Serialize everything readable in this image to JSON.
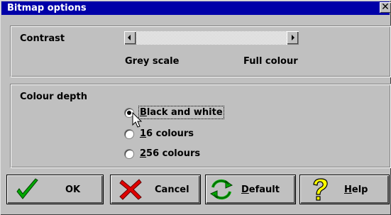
{
  "window": {
    "title": "Bitmap options",
    "close_glyph": "✕"
  },
  "contrast": {
    "label": "Contrast",
    "min_label": "Grey scale",
    "max_label": "Full colour",
    "level": 0
  },
  "colour_depth": {
    "label": "Colour depth",
    "options": [
      {
        "prefix": "",
        "mnemonic": "B",
        "rest": "lack and white",
        "selected": true
      },
      {
        "prefix": "",
        "mnemonic": "1",
        "rest": "6 colours",
        "selected": false
      },
      {
        "prefix": "",
        "mnemonic": "2",
        "rest": "56 colours",
        "selected": false
      }
    ]
  },
  "buttons": {
    "ok": {
      "label": "OK",
      "icon": "checkmark-icon"
    },
    "cancel": {
      "label": "Cancel",
      "icon": "x-icon"
    },
    "default": {
      "mnemonic": "D",
      "rest": "efault",
      "icon": "reset-arrows-icon"
    },
    "help": {
      "mnemonic": "H",
      "rest": "elp",
      "icon": "question-mark-icon"
    }
  },
  "colors": {
    "title_bar": "#0000a8",
    "face": "#c0c0c0",
    "ok_icon": "#00a800",
    "cancel_icon": "#e00000",
    "default_icon": "#00a800",
    "help_icon": "#ffff00"
  }
}
